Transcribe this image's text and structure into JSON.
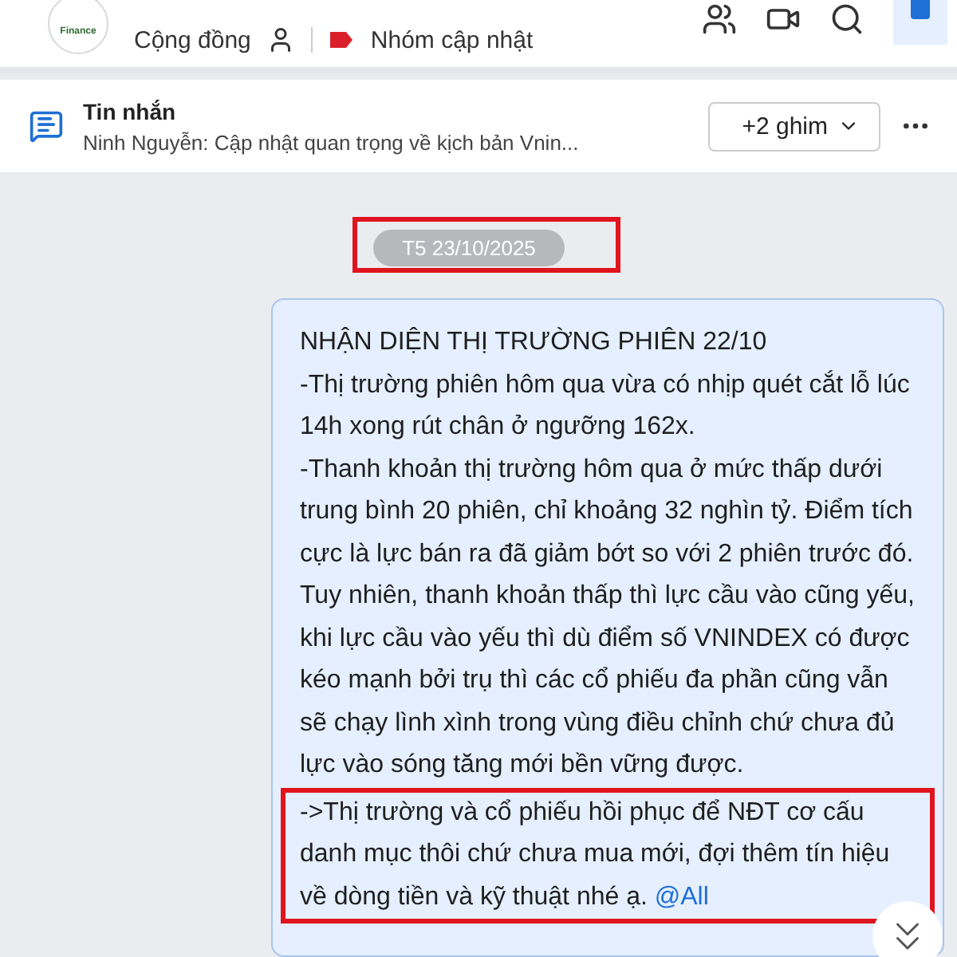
{
  "header": {
    "logo_text": "Finance",
    "subtitle": "Cộng đồng",
    "tag": "Nhóm cập nhật",
    "sidebar_toggle_selected": true
  },
  "pinned": {
    "title": "Tin nhắn",
    "preview": "Ninh Nguyễn: Cập nhật quan trọng về kịch bản Vnin...",
    "pin_button": "+2 ghim"
  },
  "chat": {
    "date": "T5 23/10/2025",
    "date_highlighted": true,
    "message": {
      "paragraphs": [
        {
          "text": "NHẬN DIỆN THỊ TRƯỜNG PHIÊN 22/10",
          "highlighted": false
        },
        {
          "text": "-Thị trường phiên hôm qua vừa có nhịp quét cắt lỗ lúc 14h xong rút chân ở ngưỡng 162x.",
          "highlighted": false
        },
        {
          "text": "-Thanh khoản thị trường hôm qua ở mức thấp dưới trung bình 20 phiên, chỉ khoảng 32 nghìn tỷ. Điểm tích cực là lực bán ra đã giảm bớt so với 2 phiên trước đó. Tuy nhiên, thanh khoản thấp thì lực cầu vào cũng yếu, khi lực cầu vào yếu thì dù điểm số VNINDEX có được kéo mạnh bởi trụ thì các cổ phiếu đa phần cũng vẫn sẽ chạy lình xình trong vùng điều chỉnh chứ chưa đủ lực vào sóng tăng mới bền vững được.",
          "highlighted": false
        },
        {
          "text": "->Thị trường và cổ phiếu hồi phục để NĐT cơ cấu danh mục thôi chứ chưa mua mới, đợi thêm tín hiệu về dòng tiền và kỹ thuật nhé ạ.",
          "mention": "@All",
          "highlighted": true
        }
      ]
    }
  }
}
